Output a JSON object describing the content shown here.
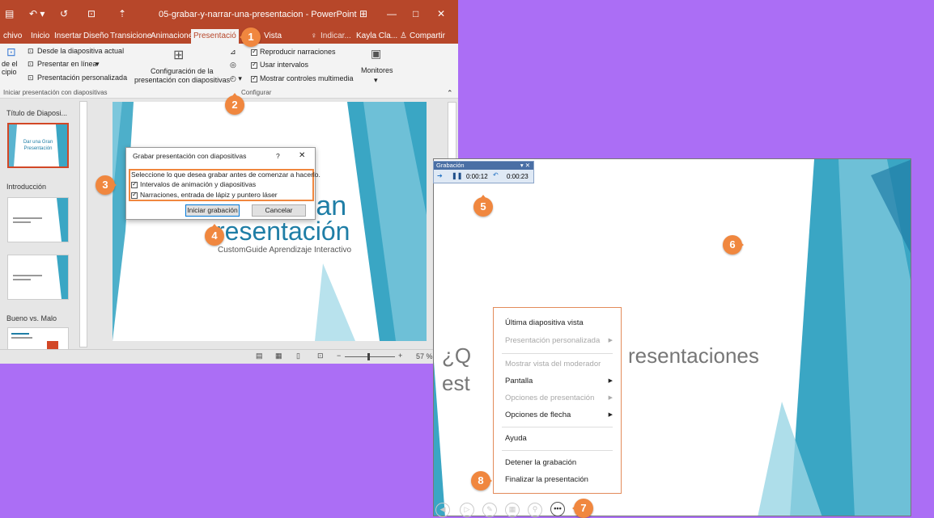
{
  "window": {
    "title": "05-grabar-y-narrar-una-presentacion - PowerPoint",
    "user": "Kayla Cla...",
    "tell_me": "Indicar...",
    "share": "Compartir"
  },
  "tabs": [
    "chivo",
    "Inicio",
    "Insertar",
    "Diseño",
    "Transicione",
    "Animacione",
    "Presentació",
    "Vista"
  ],
  "ribbon": {
    "from_current": "Desde la diapositiva actual",
    "present_online": "Presentar en línea",
    "custom_show": "Presentación personalizada",
    "from_start_1": "de el",
    "from_start_2": "cipio",
    "group_start": "Iniciar presentación con diapositivas",
    "setup_1": "Configuración de la",
    "setup_2": "presentación con diapositivas",
    "play_narrations": "Reproducir narraciones",
    "use_timings": "Usar intervalos",
    "show_media": "Mostrar controles multimedia",
    "group_config": "Configurar",
    "monitors": "Monitores"
  },
  "thumbnails": {
    "section1": "Título de Diaposi...",
    "section2": "Introducción",
    "section3": "Bueno vs. Malo",
    "slide1_text": "Dar una Gran Presentación"
  },
  "slide": {
    "title_line1": "ran",
    "title_line2": "resentación",
    "subtitle": "CustomGuide Aprendizaje Interactivo"
  },
  "dialog": {
    "title": "Grabar presentación con diapositivas",
    "help": "?",
    "close": "✕",
    "prompt": "Seleccione lo que desea grabar antes de comenzar a hacerlo.",
    "option1": "Intervalos de animación y diapositivas",
    "option2": "Narraciones, entrada de lápiz y puntero láser",
    "start": "Iniciar grabación",
    "cancel": "Cancelar"
  },
  "status": {
    "zoom": "57 %"
  },
  "recording": {
    "title": "Grabación",
    "slide_time": "0:00:12",
    "total_time": "0:00:23"
  },
  "show": {
    "title_line1a": "¿Q",
    "title_line1b": "resentaciones",
    "title_line2": "est"
  },
  "menu": {
    "items": [
      {
        "label": "Última diapositiva vista"
      },
      {
        "label": "Presentación personalizada"
      },
      {
        "label": "Mostrar vista del moderador"
      },
      {
        "label": "Pantalla"
      },
      {
        "label": "Opciones de presentación"
      },
      {
        "label": "Opciones de flecha"
      },
      {
        "label": "Ayuda"
      },
      {
        "label": "Detener la grabación"
      },
      {
        "label": "Finalizar la presentación"
      }
    ]
  },
  "badges": [
    "1",
    "2",
    "3",
    "4",
    "5",
    "6",
    "7",
    "8"
  ],
  "colors": {
    "accent": "#b7472a",
    "badge": "#f0873f",
    "background": "#ab6ef5",
    "teal": "#3aa6c4"
  }
}
